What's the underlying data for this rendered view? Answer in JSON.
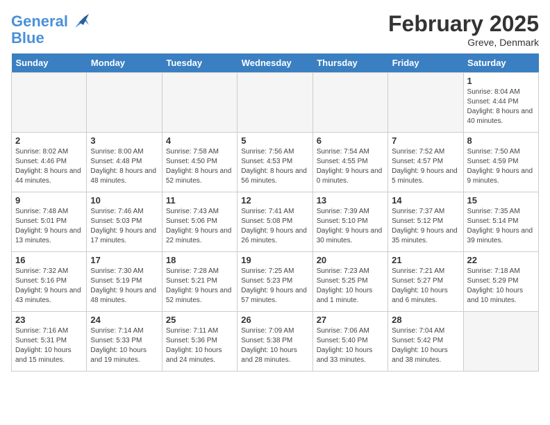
{
  "header": {
    "logo_line1": "General",
    "logo_line2": "Blue",
    "title": "February 2025",
    "subtitle": "Greve, Denmark"
  },
  "weekdays": [
    "Sunday",
    "Monday",
    "Tuesday",
    "Wednesday",
    "Thursday",
    "Friday",
    "Saturday"
  ],
  "weeks": [
    [
      {
        "day": "",
        "info": ""
      },
      {
        "day": "",
        "info": ""
      },
      {
        "day": "",
        "info": ""
      },
      {
        "day": "",
        "info": ""
      },
      {
        "day": "",
        "info": ""
      },
      {
        "day": "",
        "info": ""
      },
      {
        "day": "1",
        "info": "Sunrise: 8:04 AM\nSunset: 4:44 PM\nDaylight: 8 hours and 40 minutes."
      }
    ],
    [
      {
        "day": "2",
        "info": "Sunrise: 8:02 AM\nSunset: 4:46 PM\nDaylight: 8 hours and 44 minutes."
      },
      {
        "day": "3",
        "info": "Sunrise: 8:00 AM\nSunset: 4:48 PM\nDaylight: 8 hours and 48 minutes."
      },
      {
        "day": "4",
        "info": "Sunrise: 7:58 AM\nSunset: 4:50 PM\nDaylight: 8 hours and 52 minutes."
      },
      {
        "day": "5",
        "info": "Sunrise: 7:56 AM\nSunset: 4:53 PM\nDaylight: 8 hours and 56 minutes."
      },
      {
        "day": "6",
        "info": "Sunrise: 7:54 AM\nSunset: 4:55 PM\nDaylight: 9 hours and 0 minutes."
      },
      {
        "day": "7",
        "info": "Sunrise: 7:52 AM\nSunset: 4:57 PM\nDaylight: 9 hours and 5 minutes."
      },
      {
        "day": "8",
        "info": "Sunrise: 7:50 AM\nSunset: 4:59 PM\nDaylight: 9 hours and 9 minutes."
      }
    ],
    [
      {
        "day": "9",
        "info": "Sunrise: 7:48 AM\nSunset: 5:01 PM\nDaylight: 9 hours and 13 minutes."
      },
      {
        "day": "10",
        "info": "Sunrise: 7:46 AM\nSunset: 5:03 PM\nDaylight: 9 hours and 17 minutes."
      },
      {
        "day": "11",
        "info": "Sunrise: 7:43 AM\nSunset: 5:06 PM\nDaylight: 9 hours and 22 minutes."
      },
      {
        "day": "12",
        "info": "Sunrise: 7:41 AM\nSunset: 5:08 PM\nDaylight: 9 hours and 26 minutes."
      },
      {
        "day": "13",
        "info": "Sunrise: 7:39 AM\nSunset: 5:10 PM\nDaylight: 9 hours and 30 minutes."
      },
      {
        "day": "14",
        "info": "Sunrise: 7:37 AM\nSunset: 5:12 PM\nDaylight: 9 hours and 35 minutes."
      },
      {
        "day": "15",
        "info": "Sunrise: 7:35 AM\nSunset: 5:14 PM\nDaylight: 9 hours and 39 minutes."
      }
    ],
    [
      {
        "day": "16",
        "info": "Sunrise: 7:32 AM\nSunset: 5:16 PM\nDaylight: 9 hours and 43 minutes."
      },
      {
        "day": "17",
        "info": "Sunrise: 7:30 AM\nSunset: 5:19 PM\nDaylight: 9 hours and 48 minutes."
      },
      {
        "day": "18",
        "info": "Sunrise: 7:28 AM\nSunset: 5:21 PM\nDaylight: 9 hours and 52 minutes."
      },
      {
        "day": "19",
        "info": "Sunrise: 7:25 AM\nSunset: 5:23 PM\nDaylight: 9 hours and 57 minutes."
      },
      {
        "day": "20",
        "info": "Sunrise: 7:23 AM\nSunset: 5:25 PM\nDaylight: 10 hours and 1 minute."
      },
      {
        "day": "21",
        "info": "Sunrise: 7:21 AM\nSunset: 5:27 PM\nDaylight: 10 hours and 6 minutes."
      },
      {
        "day": "22",
        "info": "Sunrise: 7:18 AM\nSunset: 5:29 PM\nDaylight: 10 hours and 10 minutes."
      }
    ],
    [
      {
        "day": "23",
        "info": "Sunrise: 7:16 AM\nSunset: 5:31 PM\nDaylight: 10 hours and 15 minutes."
      },
      {
        "day": "24",
        "info": "Sunrise: 7:14 AM\nSunset: 5:33 PM\nDaylight: 10 hours and 19 minutes."
      },
      {
        "day": "25",
        "info": "Sunrise: 7:11 AM\nSunset: 5:36 PM\nDaylight: 10 hours and 24 minutes."
      },
      {
        "day": "26",
        "info": "Sunrise: 7:09 AM\nSunset: 5:38 PM\nDaylight: 10 hours and 28 minutes."
      },
      {
        "day": "27",
        "info": "Sunrise: 7:06 AM\nSunset: 5:40 PM\nDaylight: 10 hours and 33 minutes."
      },
      {
        "day": "28",
        "info": "Sunrise: 7:04 AM\nSunset: 5:42 PM\nDaylight: 10 hours and 38 minutes."
      },
      {
        "day": "",
        "info": ""
      }
    ]
  ]
}
